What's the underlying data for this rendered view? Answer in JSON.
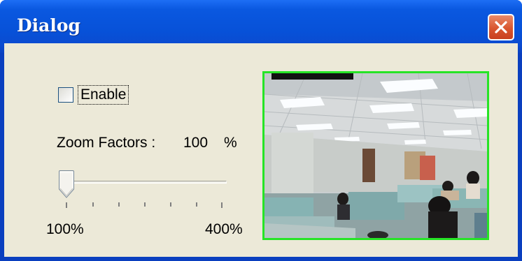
{
  "window": {
    "title": "Dialog"
  },
  "icons": {
    "close": "close-icon"
  },
  "form": {
    "enable_label": "Enable",
    "enable_checked": false,
    "zoom_label": "Zoom Factors :",
    "zoom_value": "100",
    "zoom_unit": "%",
    "slider_min_label": "100%",
    "slider_max_label": "400%",
    "slider_value_percent": 100,
    "slider_min": 100,
    "slider_max": 400
  },
  "preview": {
    "border_color": "#26e426"
  },
  "colors": {
    "titlebar": "#0a58e0",
    "client_bg": "#ece9d8",
    "close_button": "#d9562f"
  }
}
